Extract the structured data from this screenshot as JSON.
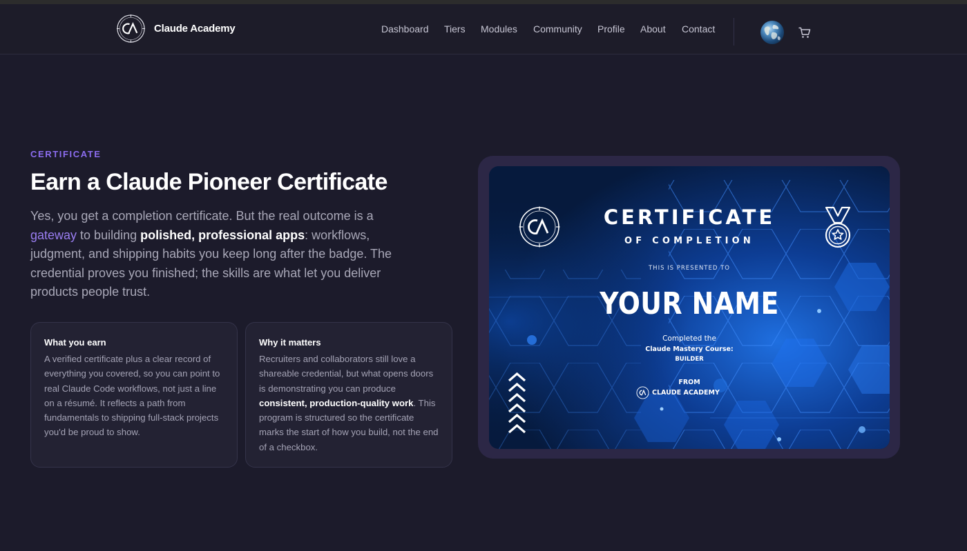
{
  "navbar": {
    "brand_name": "Claude Academy",
    "links": [
      "Dashboard",
      "Tiers",
      "Modules",
      "Community",
      "Profile",
      "About",
      "Contact"
    ],
    "avatar_icon": "earth-avatar",
    "cart_icon": "cart-icon"
  },
  "hero": {
    "eyebrow": "CERTIFICATE",
    "headline": "Earn a Claude Pioneer Certificate",
    "lead_1": "Yes, you get a completion certificate. But the real outcome is a ",
    "lead_accent": "gateway",
    "lead_2": " to building ",
    "lead_strong": "polished, professional apps",
    "lead_3": ": workflows, judgment, and shipping habits you keep long after the badge. The credential proves you finished; the skills are what let you deliver products people trust."
  },
  "cards": [
    {
      "title": "What you earn",
      "body": "A verified certificate plus a clear record of everything you covered, so you can point to real Claude Code workflows, not just a line on a résumé. It reflects a path from fundamentals to shipping full-stack projects you'd be proud to show."
    },
    {
      "title": "Why it matters",
      "body_1": "Recruiters and collaborators still love a shareable credential, but what opens doors is demonstrating you can produce ",
      "body_strong": "consistent, production-quality work",
      "body_2": ". This program is structured so the certificate marks the start of how you build, not the end of a checkbox."
    }
  ],
  "certificate": {
    "title": "CERTIFICATE",
    "subtitle": "OF COMPLETION",
    "presented": "THIS IS PRESENTED TO",
    "name": "YOUR NAME",
    "completed": "Completed the",
    "course": "Claude Mastery Course:",
    "level": "BUILDER",
    "from": "FROM",
    "academy": "CLAUDE ACADEMY",
    "logo_text": "CA",
    "medal_icon": "medal-star-icon",
    "background": "blue-hexagon-pattern"
  },
  "colors": {
    "page_bg": "#1c1b2b",
    "accent_purple": "#8c6df0",
    "card_bg": "#232233",
    "certificate_blue": "#061a3d"
  }
}
